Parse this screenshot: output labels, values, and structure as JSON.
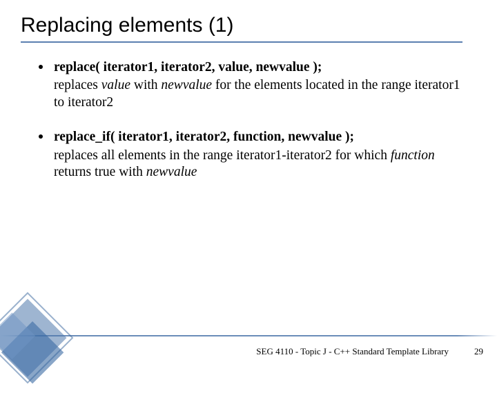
{
  "title": "Replacing elements (1)",
  "bullets": [
    {
      "signature": "replace( iterator1, iterator2, value, newvalue );",
      "desc_pre": "replaces ",
      "desc_i1": "value",
      "desc_mid1": " with ",
      "desc_i2": "newvalue",
      "desc_post": " for the elements located in the range iterator1 to iterator2"
    },
    {
      "signature": "replace_if( iterator1, iterator2, function, newvalue );",
      "desc_pre": "replaces all elements in the range iterator1-iterator2 for which ",
      "desc_i1": "function",
      "desc_mid1": " returns true with ",
      "desc_i2": "newvalue",
      "desc_post": ""
    }
  ],
  "footer": "SEG 4110 - Topic J - C++ Standard Template Library",
  "page": "29"
}
